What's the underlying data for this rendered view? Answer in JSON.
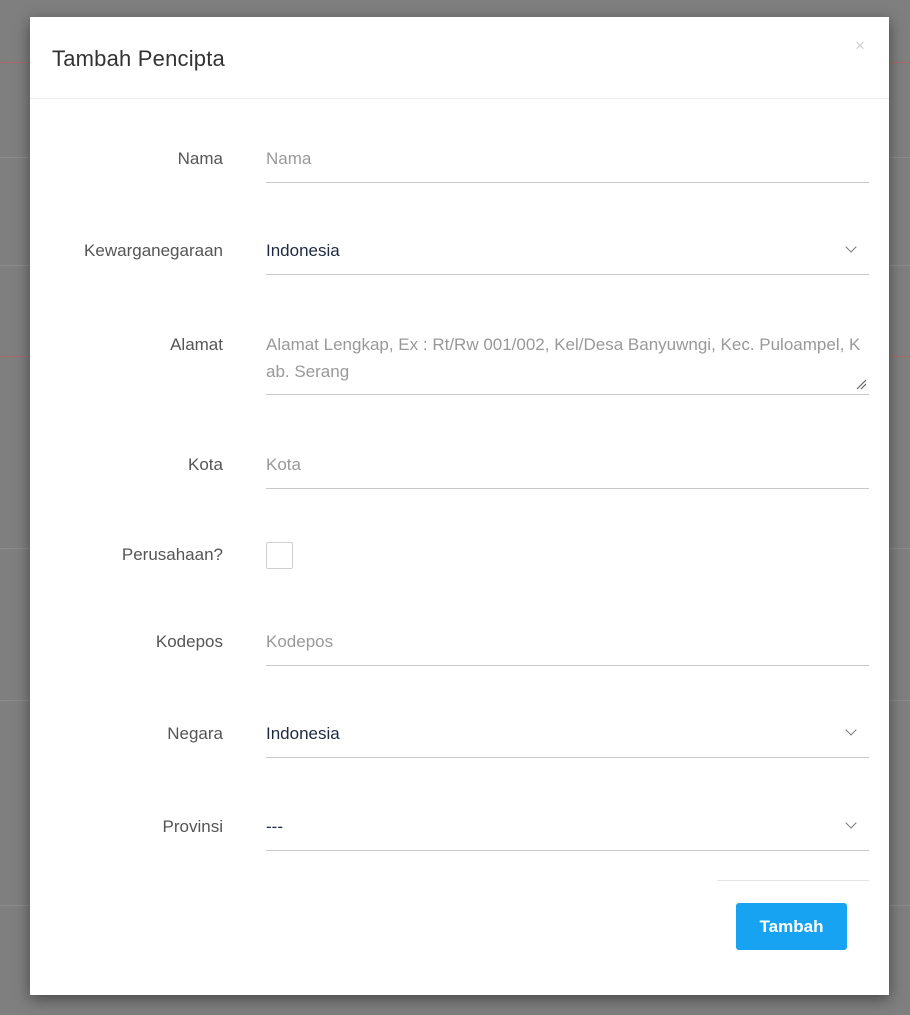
{
  "modal": {
    "title": "Tambah Pencipta",
    "close_symbol": "×"
  },
  "form": {
    "nama": {
      "label": "Nama",
      "placeholder": "Nama",
      "value": ""
    },
    "kewarganegaraan": {
      "label": "Kewarganegaraan",
      "selected": "Indonesia"
    },
    "alamat": {
      "label": "Alamat",
      "placeholder": "Alamat Lengkap, Ex : Rt/Rw 001/002, Kel/Desa Banyuwngi, Kec. Puloampel, Kab. Serang",
      "value": ""
    },
    "kota": {
      "label": "Kota",
      "placeholder": "Kota",
      "value": ""
    },
    "perusahaan": {
      "label": "Perusahaan?",
      "checked": false
    },
    "kodepos": {
      "label": "Kodepos",
      "placeholder": "Kodepos",
      "value": ""
    },
    "negara": {
      "label": "Negara",
      "selected": "Indonesia"
    },
    "provinsi": {
      "label": "Provinsi",
      "selected": "---"
    }
  },
  "actions": {
    "submit_label": "Tambah"
  },
  "colors": {
    "accent": "#17a2f2",
    "overlay": "#7f7f7f",
    "label": "#555555",
    "placeholder": "#999999",
    "value": "#1f2940"
  },
  "icons": {
    "close": "close-icon",
    "dropdown": "chevron-down-icon",
    "resize": "resize-handle-icon"
  }
}
